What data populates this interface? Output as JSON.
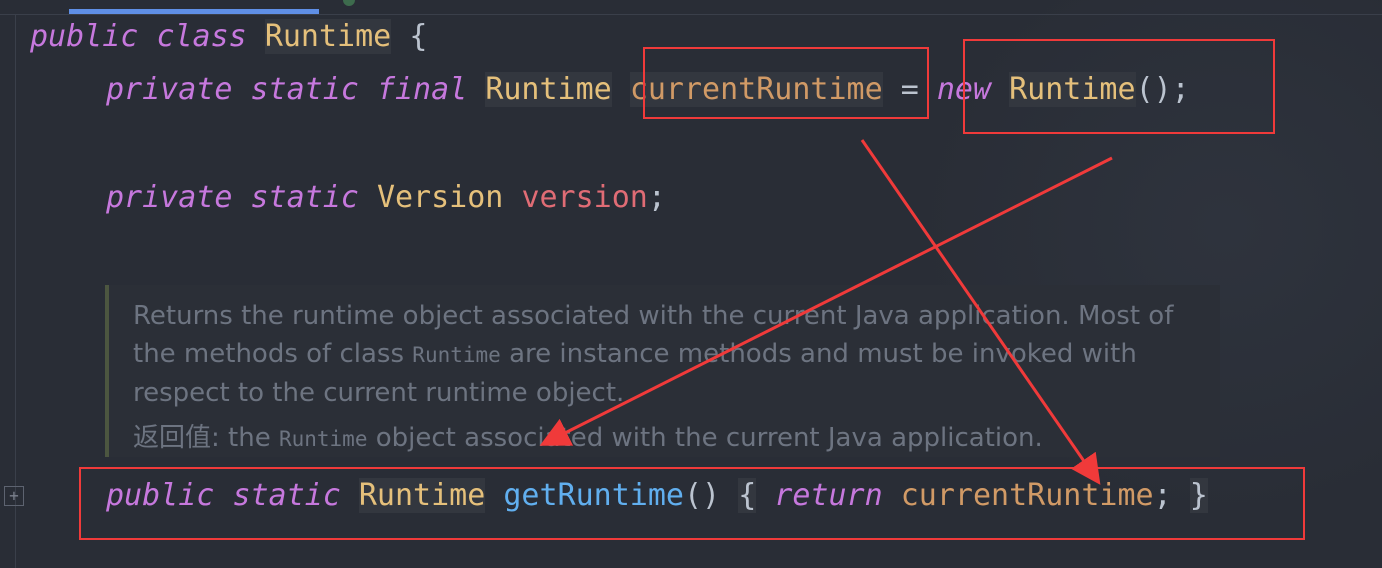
{
  "editor": {
    "line1": {
      "kw1": "public",
      "kw2": "class",
      "name": "Runtime",
      "brace": "{"
    },
    "line2": {
      "kw1": "private",
      "kw2": "static",
      "kw3": "final",
      "type": "Runtime",
      "field": "currentRuntime",
      "eq": "=",
      "kw_new": "new",
      "ctor": "Runtime",
      "tail": "();"
    },
    "line3": {
      "kw1": "private",
      "kw2": "static",
      "type": "Version",
      "field": "version",
      "semi": ";"
    },
    "doc": {
      "part1": "Returns the runtime object associated with the current Java application. Most of the methods of class ",
      "code1": "Runtime",
      "part2": " are instance methods and must be invoked with respect to the current runtime object.",
      "return_label": "返回值:",
      "return_part1": " the ",
      "return_code": "Runtime",
      "return_part2": " object associated with the current Java application."
    },
    "line4": {
      "kw1": "public",
      "kw2": "static",
      "type": "Runtime",
      "method": "getRuntime",
      "parens": "()",
      "open": "{",
      "kw_return": "return",
      "field": "currentRuntime",
      "semi": ";",
      "close": "}"
    },
    "fold_icon": "plus-box-icon",
    "accent_colors": {
      "annotation_red": "#f03a3a",
      "tab_underline": "#5f8fe6"
    }
  }
}
